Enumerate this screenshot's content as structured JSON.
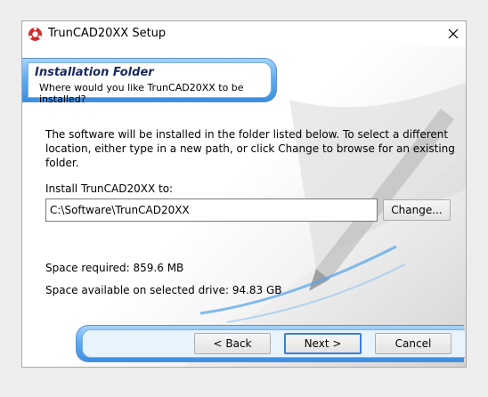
{
  "window": {
    "title": "TrunCAD20XX Setup",
    "app_icon": "truncad-logo-icon",
    "close_icon": "close-icon"
  },
  "header": {
    "title": "Installation Folder",
    "subtitle": "Where would you like TrunCAD20XX to be installed?"
  },
  "body": {
    "description": "The software will be installed in the folder listed below. To select a different location, either type in a new path, or click Change to browse for an existing folder.",
    "install_label": "Install TrunCAD20XX to:",
    "install_path": "C:\\Software\\TrunCAD20XX",
    "change_button": "Change...",
    "space_required": "Space required: 859.6 MB",
    "space_available": "Space available on selected drive: 94.83 GB"
  },
  "footer": {
    "back_button": "< Back",
    "next_button": "Next >",
    "cancel_button": "Cancel"
  },
  "colors": {
    "banner_blue": "#3c8de0",
    "banner_light": "#a5d4fb",
    "header_title": "#1a2a60",
    "default_button_border": "#3c7fd6"
  }
}
